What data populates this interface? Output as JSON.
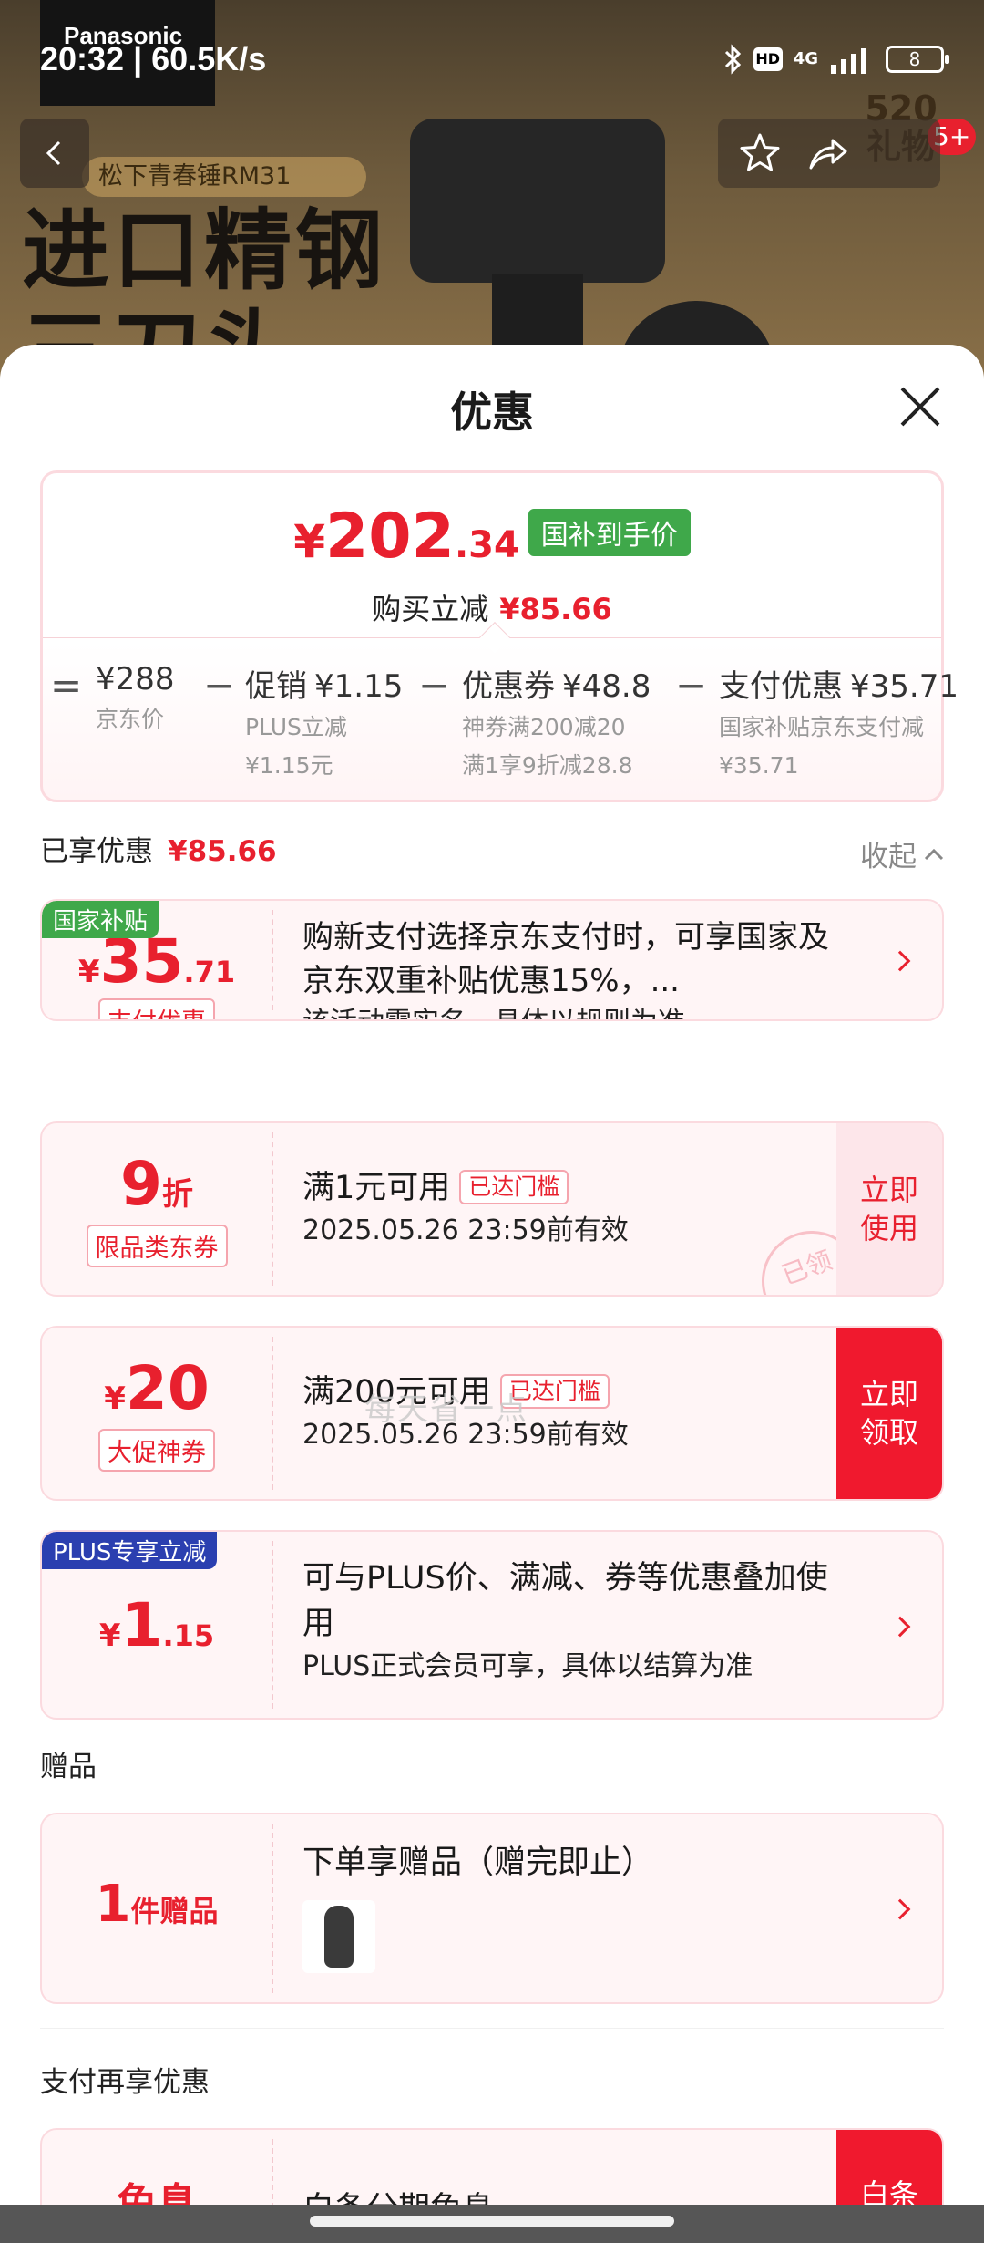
{
  "status_bar": {
    "time": "20:32 | 60.5K/s",
    "network": "4G",
    "hd": "HD",
    "battery": "8"
  },
  "product_page": {
    "brand_logo": "Panasonic",
    "tagline": "松下青春锤RM31",
    "headline_line1": "进口精钢",
    "headline_line2": "三刀头",
    "promo_badge_line1": "520",
    "promo_badge_line2": "礼物",
    "cart_count": "5+"
  },
  "sheet": {
    "title": "优惠",
    "summary": {
      "price_symbol": "¥",
      "price_int": "202",
      "price_dec": ".34",
      "price_tag": "国补到手价",
      "reduce_label": "购买立减",
      "reduce_amount": "¥85.66",
      "breakdown": [
        {
          "op": "=",
          "main": "¥288",
          "sub1": "京东价",
          "sub2": ""
        },
        {
          "op": "−",
          "main": "促销",
          "num": "¥1.15",
          "sub1": "PLUS立减",
          "sub2": "¥1.15元"
        },
        {
          "op": "−",
          "main": "优惠券",
          "num": "¥48.8",
          "sub1": "神券满200减20",
          "sub2": "满1享9折减28.8"
        },
        {
          "op": "−",
          "main": "支付优惠",
          "num": "¥35.71",
          "sub1": "国家补贴京东支付减",
          "sub2": "¥35.71"
        }
      ]
    },
    "enjoyed_label": "已享优惠",
    "enjoyed_amount": "¥85.66",
    "collapse_label": "收起",
    "cards": {
      "subsidy": {
        "corner": "国家补贴",
        "yen": "¥",
        "int": "35",
        "dec": ".71",
        "pill": "支付优惠",
        "title": "购新支付选择京东支付时，可享国家及京东双重补贴优惠15%，...",
        "desc": "该活动需实名，具体以规则为准"
      },
      "discount": {
        "int": "9",
        "unit": "折",
        "pill": "限品类东券",
        "title": "满1元可用",
        "reached": "已达门槛",
        "desc": "2025.05.26 23:59前有效",
        "action_line1": "立即",
        "action_line2": "使用",
        "stamp": "已领"
      },
      "shenquan": {
        "yen": "¥",
        "int": "20",
        "pill": "大促神券",
        "title": "满200元可用",
        "reached": "已达门槛",
        "desc": "2025.05.26 23:59前有效",
        "action_line1": "立即",
        "action_line2": "领取"
      },
      "plus": {
        "corner": "PLUS专享立减",
        "yen": "¥",
        "int": "1",
        "dec": ".15",
        "title": "可与PLUS价、满减、券等优惠叠加使用",
        "desc": "PLUS正式会员可享，具体以结算为准"
      },
      "gift": {
        "int": "1",
        "unit": "件赠品",
        "title": "下单享赠品（赠完即止）"
      },
      "pay": {
        "title_partial": "免息",
        "desc_partial": "白条",
        "body_partial": "白条分期免息"
      }
    },
    "watermark": "每天省一点",
    "gift_section_label": "赠品",
    "pay_section_label": "支付再享优惠"
  },
  "colors": {
    "accent": "#e8202e",
    "green_tag": "#3fa84a",
    "plus_blue": "#2b3fb0"
  }
}
